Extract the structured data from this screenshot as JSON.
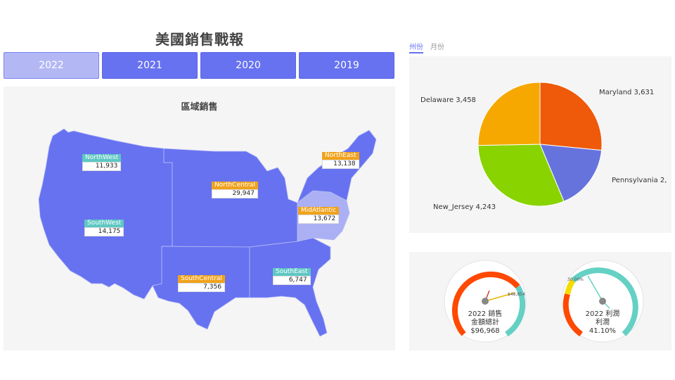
{
  "page": {
    "title": "美國銷售戰報"
  },
  "year_tabs": [
    {
      "label": "2022",
      "active": true
    },
    {
      "label": "2021",
      "active": false
    },
    {
      "label": "2020",
      "active": false
    },
    {
      "label": "2019",
      "active": false
    }
  ],
  "map": {
    "title": "區域銷售",
    "regions": [
      {
        "name": "NorthWest",
        "value": "11,933"
      },
      {
        "name": "NorthEast",
        "value": "13,138"
      },
      {
        "name": "NorthCentral",
        "value": "29,947"
      },
      {
        "name": "MidAtlantic",
        "value": "13,672"
      },
      {
        "name": "SouthWest",
        "value": "14,175"
      },
      {
        "name": "SouthCentral",
        "value": "7,356"
      },
      {
        "name": "SouthEast",
        "value": "6,747"
      }
    ],
    "colors": {
      "region": "#6772f0",
      "highlight": "#aab0f3",
      "teal_label": "#5ec7c3",
      "orange_label": "#f0a21c"
    }
  },
  "chart_tabs": [
    {
      "label": "州份",
      "active": true
    },
    {
      "label": "月份",
      "active": false
    }
  ],
  "chart_data": {
    "type": "pie",
    "slices": [
      {
        "label": "Maryland 3,631",
        "value": 3631,
        "color": "#ee5a09"
      },
      {
        "label": "Pennsylvania 2,",
        "value": 2340,
        "color": "#6773dd"
      },
      {
        "label": "New_Jersey 4,243",
        "value": 4243,
        "color": "#88d300"
      },
      {
        "label": "Delaware 3,458",
        "value": 3458,
        "color": "#f6a800"
      }
    ]
  },
  "gauges": [
    {
      "title": "2022 銷售",
      "subtitle": "金額總計",
      "value": "$96,968",
      "tick_label": "$48,854",
      "colors": {
        "main": "#ff4800",
        "end": "#65d0c4"
      }
    },
    {
      "title": "2022 利潤",
      "subtitle": "利潤",
      "value": "41.10%",
      "tick_label": "30.00%",
      "colors": {
        "start": "#ff4800",
        "mid": "#f4dc00",
        "main": "#65d0c4"
      }
    }
  ]
}
